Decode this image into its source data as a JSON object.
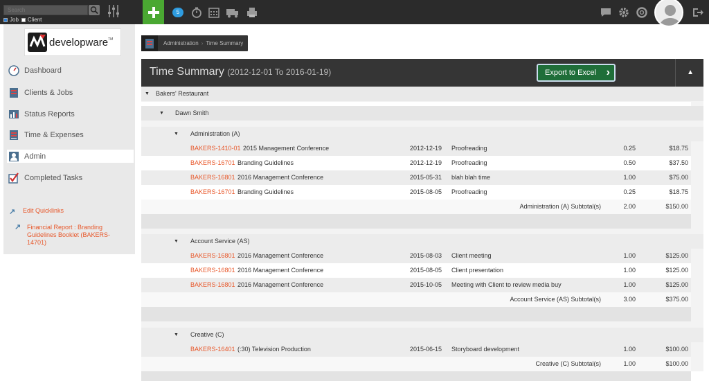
{
  "search": {
    "placeholder": "Search",
    "opt_job": "Job",
    "opt_client": "Client"
  },
  "badge_count": "5",
  "sidebar": {
    "logo_text": "developware",
    "logo_tm": "TM",
    "items": [
      {
        "label": "Dashboard",
        "icon": "dashboard-icon"
      },
      {
        "label": "Clients & Jobs",
        "icon": "clients-icon"
      },
      {
        "label": "Status Reports",
        "icon": "chart-icon"
      },
      {
        "label": "Time & Expenses",
        "icon": "timesheet-icon"
      },
      {
        "label": "Admin",
        "icon": "admin-icon"
      },
      {
        "label": "Completed Tasks",
        "icon": "check-icon"
      }
    ],
    "quicklinks": [
      {
        "label": "Edit Quicklinks"
      },
      {
        "label": "Financial Report : Branding Guidelines Booklet (BAKERS-14701)"
      }
    ]
  },
  "breadcrumb": {
    "items": [
      "Administration",
      "Time Summary"
    ]
  },
  "panel": {
    "title": "Time Summary",
    "date_range": "(2012-12-01 To 2016-01-19)",
    "export_label": "Export to Excel"
  },
  "report": {
    "client": "Bakers' Restaurant",
    "person": "Dawn Smith",
    "groups": [
      {
        "name": "Administration (A)",
        "entries": [
          {
            "code": "BAKERS-1410-01",
            "job": "2015 Management Conference",
            "date": "2012-12-19",
            "task": "Proofreading",
            "hours": "0.25",
            "amount": "$18.75"
          },
          {
            "code": "BAKERS-16701",
            "job": "Branding Guidelines",
            "date": "2012-12-19",
            "task": "Proofreading",
            "hours": "0.50",
            "amount": "$37.50"
          },
          {
            "code": "BAKERS-16801",
            "job": "2016 Management Conference",
            "date": "2015-05-31",
            "task": "blah blah time",
            "hours": "1.00",
            "amount": "$75.00"
          },
          {
            "code": "BAKERS-16701",
            "job": "Branding Guidelines",
            "date": "2015-08-05",
            "task": "Proofreading",
            "hours": "0.25",
            "amount": "$18.75"
          }
        ],
        "subtotal_label": "Administration (A) Subtotal(s)",
        "subtotal_hours": "2.00",
        "subtotal_amount": "$150.00"
      },
      {
        "name": "Account Service (AS)",
        "entries": [
          {
            "code": "BAKERS-16801",
            "job": "2016 Management Conference",
            "date": "2015-08-03",
            "task": "Client meeting",
            "hours": "1.00",
            "amount": "$125.00"
          },
          {
            "code": "BAKERS-16801",
            "job": "2016 Management Conference",
            "date": "2015-08-05",
            "task": "Client presentation",
            "hours": "1.00",
            "amount": "$125.00"
          },
          {
            "code": "BAKERS-16801",
            "job": "2016 Management Conference",
            "date": "2015-10-05",
            "task": "Meeting with Client to review media buy",
            "hours": "1.00",
            "amount": "$125.00"
          }
        ],
        "subtotal_label": "Account Service (AS) Subtotal(s)",
        "subtotal_hours": "3.00",
        "subtotal_amount": "$375.00"
      },
      {
        "name": "Creative (C)",
        "entries": [
          {
            "code": "BAKERS-16401",
            "job": "(:30) Television Production",
            "date": "2015-06-15",
            "task": "Storyboard development",
            "hours": "1.00",
            "amount": "$100.00"
          }
        ],
        "subtotal_label": "Creative (C) Subtotal(s)",
        "subtotal_hours": "1.00",
        "subtotal_amount": "$100.00"
      }
    ]
  },
  "colors": {
    "accent_green": "#4aa832",
    "export_green": "#1f6e39",
    "link_orange": "#e8582b",
    "topbar": "#2b2b2b"
  }
}
